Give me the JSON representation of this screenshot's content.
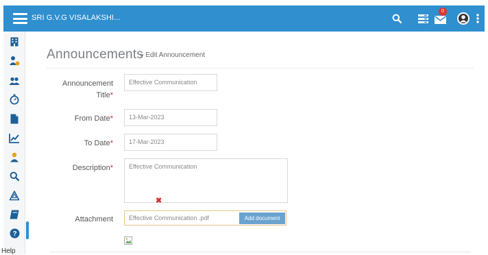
{
  "header": {
    "brand": "SRI G.V.G VISALAKSHI...",
    "notification_count": "0",
    "bg_color": "#2f8fcf"
  },
  "sidebar": {
    "items": [
      {
        "icon": "building-icon"
      },
      {
        "icon": "user-money-icon"
      },
      {
        "icon": "users-icon"
      },
      {
        "icon": "stopwatch-icon"
      },
      {
        "icon": "document-icon"
      },
      {
        "icon": "chart-icon"
      },
      {
        "icon": "user-icon"
      },
      {
        "icon": "search-icon"
      },
      {
        "icon": "recycle-icon"
      },
      {
        "icon": "book-icon"
      },
      {
        "icon": "help-icon"
      }
    ],
    "help_label": "Help"
  },
  "page": {
    "title": "Announcements",
    "breadcrumb": "» Edit Announcement"
  },
  "form": {
    "title_label_line1": "Announcement",
    "title_label_line2": "Title",
    "title_value": "Effective Communication",
    "from_date_label": "From Date",
    "from_date_value": "13-Mar-2023",
    "to_date_label": "To Date",
    "to_date_value": "17-Mar-2023",
    "description_label": "Description",
    "description_value": "Effective Communication",
    "attachment_label": "Attachment",
    "attachment_value": "Effective Communication .pdf",
    "add_document_label": "Add document",
    "required_mark": "*",
    "remove_mark": "✖"
  }
}
